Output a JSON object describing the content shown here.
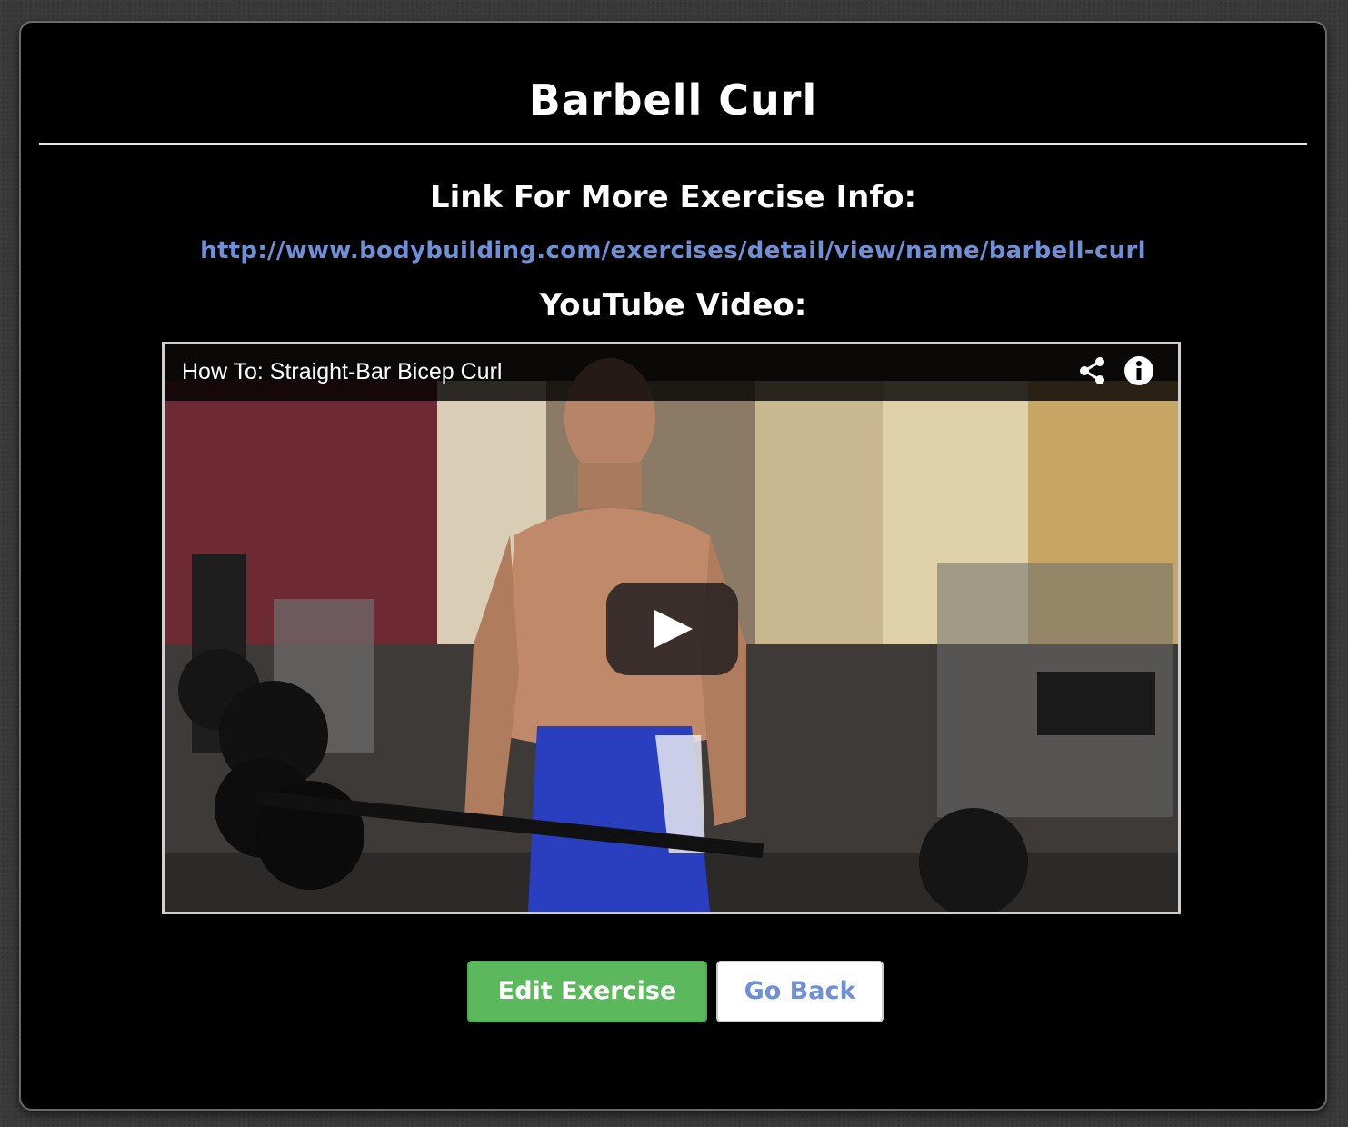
{
  "page": {
    "title": "Barbell Curl"
  },
  "info": {
    "heading": "Link For More Exercise Info:",
    "link_text": "http://www.bodybuilding.com/exercises/detail/view/name/barbell-curl"
  },
  "video": {
    "heading": "YouTube Video:",
    "title": "How To: Straight-Bar Bicep Curl",
    "icons": [
      "share-icon",
      "info-icon",
      "play-icon"
    ]
  },
  "actions": {
    "edit_label": "Edit Exercise",
    "back_label": "Go Back"
  },
  "colors": {
    "background": "#000000",
    "link": "#6f8fd6",
    "edit_button": "#5cb85c",
    "back_button": "#ffffff"
  }
}
